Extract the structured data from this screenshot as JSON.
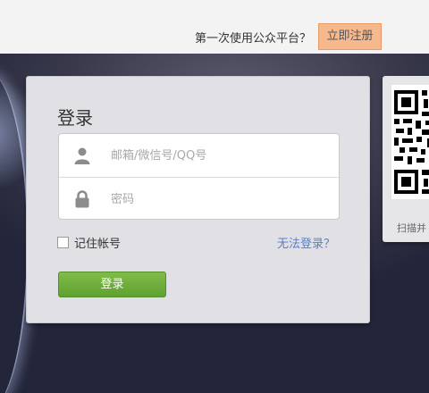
{
  "topbar": {
    "prompt": "第一次使用公众平台？",
    "register_label": "立即注册"
  },
  "login": {
    "title": "登录",
    "username_placeholder": "邮箱/微信号/QQ号",
    "password_placeholder": "密码",
    "remember_label": "记住帐号",
    "forgot_label": "无法登录？",
    "submit_label": "登录"
  },
  "qr": {
    "hint": "扫描并"
  },
  "icons": {
    "user": "user-icon",
    "lock": "lock-icon",
    "qr": "qr-code-icon"
  },
  "colors": {
    "register_bg": "#f5b98d",
    "login_button": "#6aad39",
    "forgot_link": "#5b7ec9"
  }
}
